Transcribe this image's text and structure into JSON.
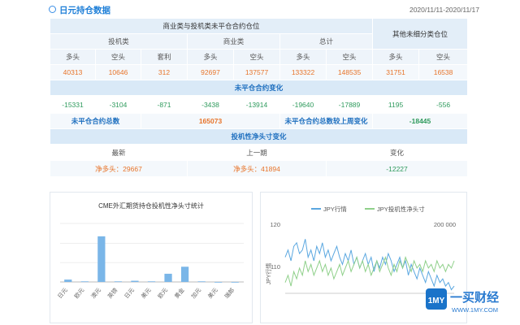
{
  "header": {
    "title": "日元持仓数据",
    "date_range": "2020/11/11-2020/11/17"
  },
  "table": {
    "title_main": "商业类与投机类未平仓合约仓位",
    "title_other": "其他未细分类仓位",
    "group_spec": "投机类",
    "group_comm": "商业类",
    "group_total": "总计",
    "cols": [
      "多头",
      "空头",
      "套利",
      "多头",
      "空头",
      "多头",
      "空头",
      "多头",
      "空头"
    ],
    "values": [
      "40313",
      "10646",
      "312",
      "92697",
      "137577",
      "133322",
      "148535",
      "31751",
      "16538"
    ],
    "change_title": "未平仓合约变化",
    "changes": [
      "-15331",
      "-3104",
      "-871",
      "-3438",
      "-13914",
      "-19640",
      "-17889",
      "1195",
      "-556"
    ],
    "total_label": "未平仓合约总数",
    "total_value": "165073",
    "weekly_change_label": "未平仓合约总数较上周变化",
    "weekly_change_value": "-18445",
    "net_title": "投机性净头寸变化",
    "net_headers": [
      "最新",
      "上一期",
      "变化"
    ],
    "net_latest": "净多头：29667",
    "net_prev": "净多头：41894",
    "net_change": "-12227"
  },
  "chart_data": [
    {
      "type": "bar",
      "title": "CME外汇期货持仓投机性净头寸统计",
      "categories": [
        "日元",
        "欧元",
        "澳元",
        "英镑",
        "日元",
        "美元",
        "欧元",
        "黄金",
        "加元",
        "美元",
        "瑞郎"
      ],
      "values": [
        4,
        1,
        78,
        1,
        2,
        1,
        14,
        26,
        1,
        0,
        0
      ],
      "ylim": [
        0,
        100
      ],
      "color": "#7ab6e8"
    },
    {
      "type": "line",
      "series": [
        {
          "name": "JPY行情",
          "color": "#5aa7e0",
          "values": [
            114,
            116,
            113,
            117,
            118,
            115,
            116,
            119,
            114,
            116,
            113,
            117,
            115,
            118,
            114,
            116,
            113,
            115,
            117,
            114,
            112,
            115,
            113,
            116,
            112,
            114,
            111,
            113,
            115,
            112,
            114,
            110,
            113,
            111,
            114,
            112,
            115,
            113,
            110,
            112,
            114,
            111,
            113,
            109,
            112,
            110,
            108,
            111,
            109,
            107,
            110,
            108,
            106,
            109,
            107,
            108,
            106,
            107,
            105,
            106
          ]
        },
        {
          "name": "JPY投机性净头寸",
          "color": "#8fd08a",
          "values": [
            107,
            109,
            106,
            110,
            108,
            111,
            109,
            113,
            110,
            112,
            109,
            111,
            113,
            110,
            112,
            109,
            111,
            108,
            110,
            112,
            109,
            111,
            113,
            110,
            112,
            114,
            111,
            113,
            110,
            112,
            109,
            111,
            113,
            110,
            112,
            114,
            111,
            109,
            112,
            110,
            113,
            111,
            114,
            112,
            110,
            113,
            111,
            112,
            110,
            113,
            111,
            112,
            110,
            113,
            111,
            112,
            110,
            112,
            111,
            113
          ]
        }
      ],
      "ylabel_left": "JPY行情",
      "y_left_ticks": [
        "120",
        "110"
      ],
      "y_right_ticks": [
        "200 000"
      ],
      "ylim": [
        104,
        122
      ]
    }
  ],
  "logo": {
    "text": "一买财经",
    "url": "WWW.1MY.COM"
  }
}
